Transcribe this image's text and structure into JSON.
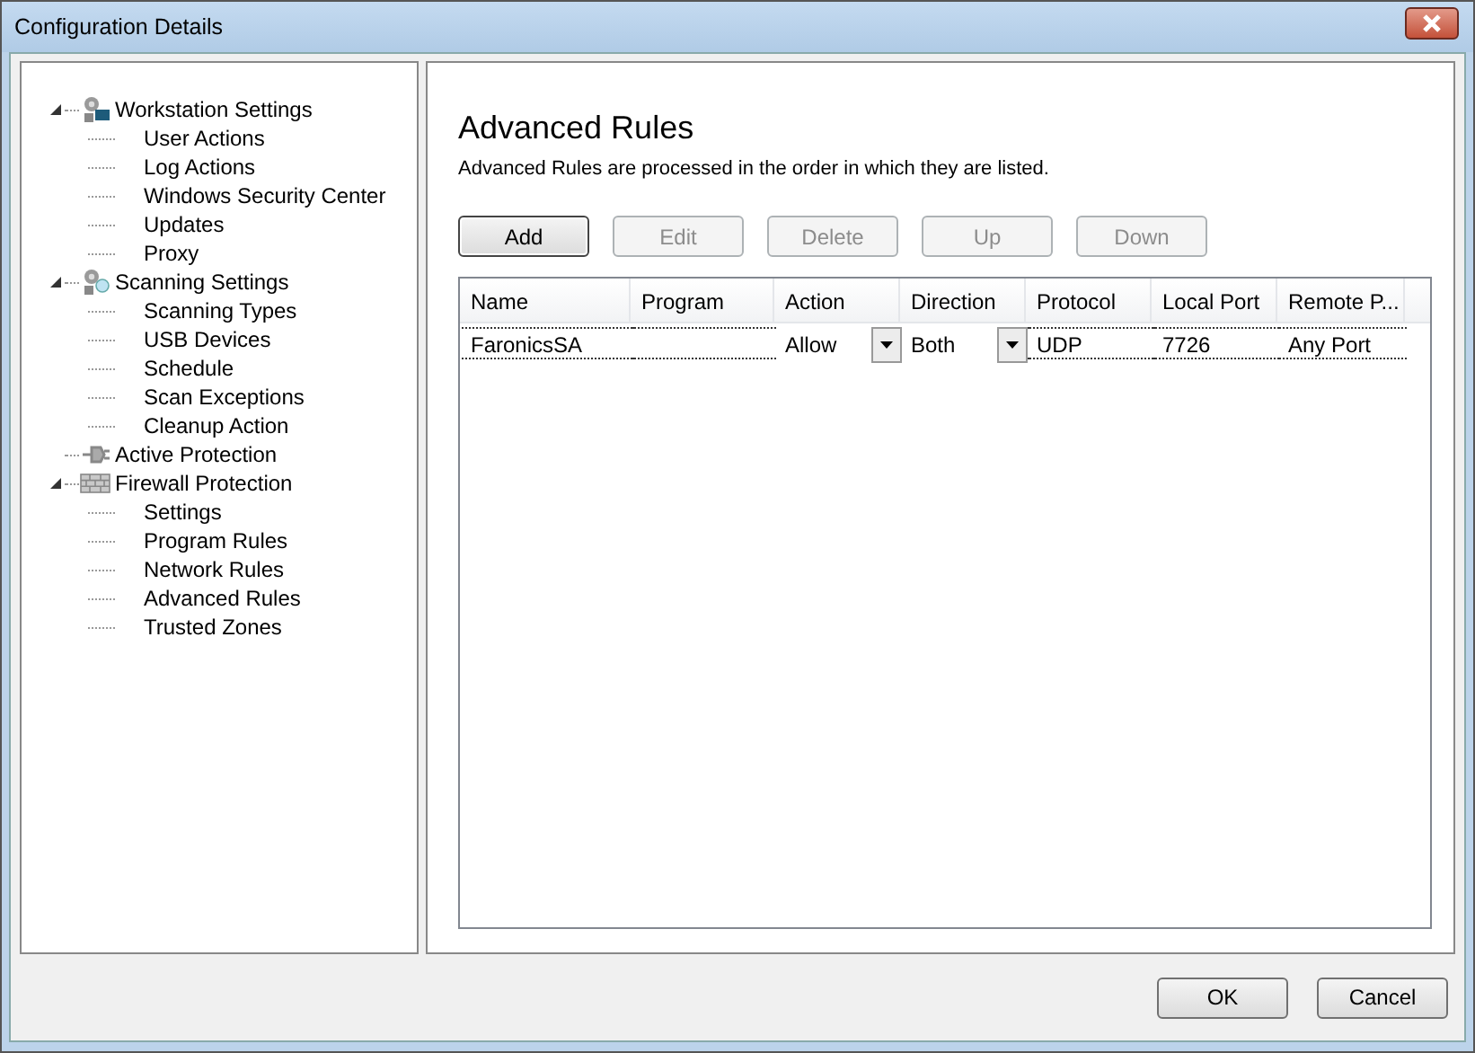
{
  "window": {
    "title": "Configuration Details"
  },
  "tree": [
    {
      "label": "Workstation Settings",
      "kind": "workstation",
      "expanded": true,
      "children": [
        {
          "label": "User Actions"
        },
        {
          "label": "Log Actions"
        },
        {
          "label": "Windows Security Center"
        },
        {
          "label": "Updates"
        },
        {
          "label": "Proxy"
        }
      ]
    },
    {
      "label": "Scanning Settings",
      "kind": "scanning",
      "expanded": true,
      "children": [
        {
          "label": "Scanning Types"
        },
        {
          "label": "USB Devices"
        },
        {
          "label": "Schedule"
        },
        {
          "label": "Scan Exceptions"
        },
        {
          "label": "Cleanup Action"
        }
      ]
    },
    {
      "label": "Active Protection",
      "kind": "protection"
    },
    {
      "label": "Firewall Protection",
      "kind": "firewall",
      "expanded": true,
      "children": [
        {
          "label": "Settings"
        },
        {
          "label": "Program Rules"
        },
        {
          "label": "Network Rules"
        },
        {
          "label": "Advanced Rules"
        },
        {
          "label": "Trusted Zones"
        }
      ]
    }
  ],
  "page": {
    "title": "Advanced Rules",
    "description": "Advanced Rules are processed in the order in which they are listed."
  },
  "buttons": [
    {
      "label": "Add",
      "disabled": false
    },
    {
      "label": "Edit",
      "disabled": true
    },
    {
      "label": "Delete",
      "disabled": true
    },
    {
      "label": "Up",
      "disabled": true
    },
    {
      "label": "Down",
      "disabled": true
    }
  ],
  "table": {
    "columns": [
      "Name",
      "Program",
      "Action",
      "Direction",
      "Protocol",
      "Local Port",
      "Remote P..."
    ],
    "rows": [
      {
        "cells": [
          {
            "text": "FaronicsSA",
            "kind": "text"
          },
          {
            "kind": "blank"
          },
          {
            "text": "Allow",
            "kind": "combo"
          },
          {
            "text": "Both",
            "kind": "combo"
          },
          {
            "text": "UDP",
            "kind": "text"
          },
          {
            "text": "7726",
            "kind": "text"
          },
          {
            "text": "Any Port",
            "kind": "text"
          }
        ]
      }
    ]
  },
  "footer_buttons": [
    "OK",
    "Cancel"
  ]
}
